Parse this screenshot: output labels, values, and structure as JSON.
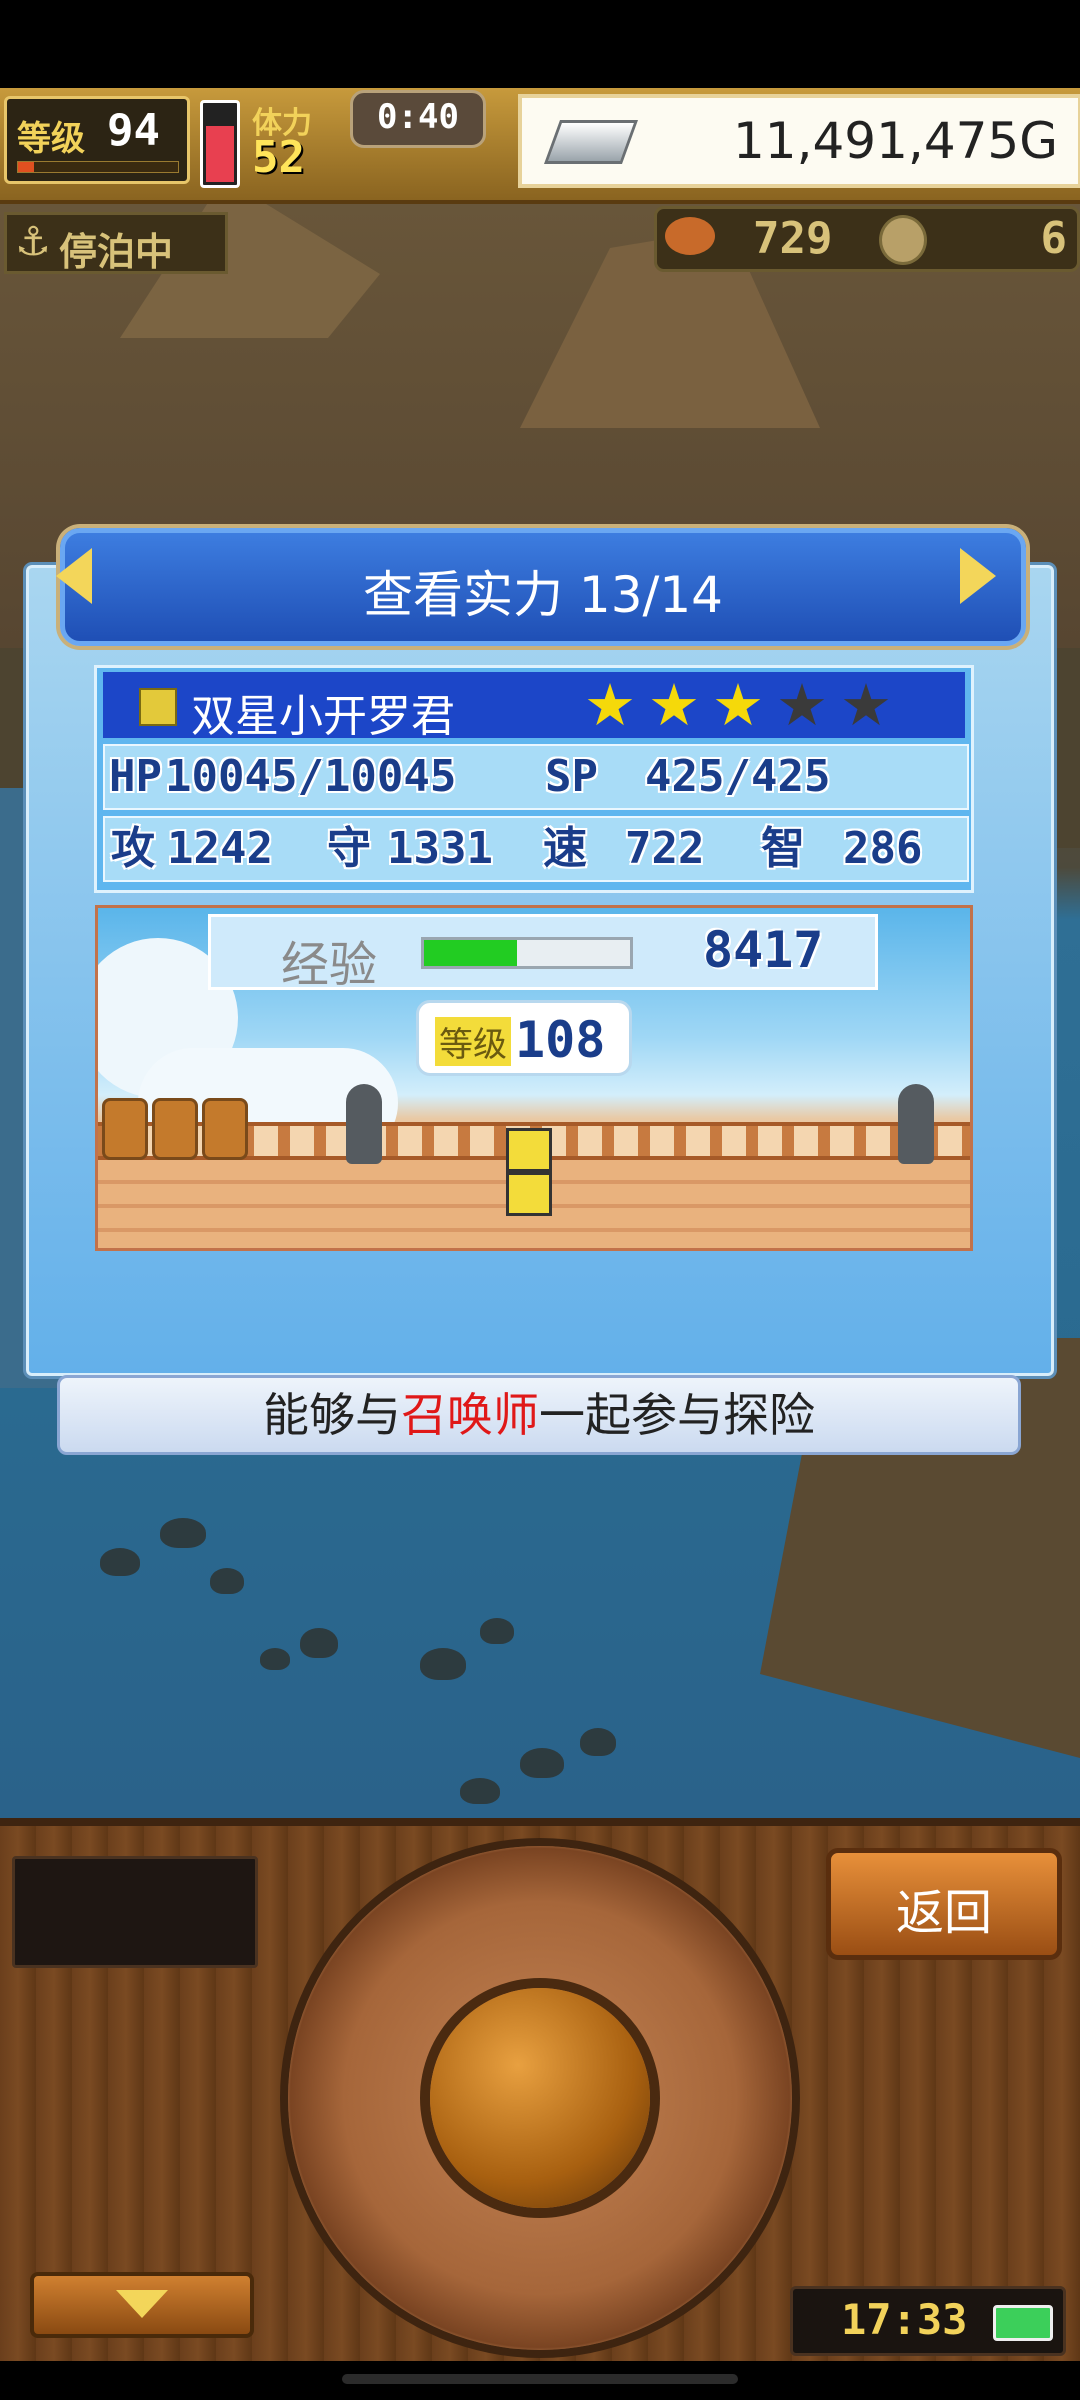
{
  "hud": {
    "level_label": "等级",
    "level_value": "94",
    "stamina_label": "体力",
    "stamina_value": "52",
    "timer": "0:40",
    "gold": "11,491,475G",
    "status": "停泊中",
    "food_value": "729",
    "medal_value": "6"
  },
  "dialog": {
    "title": "查看实力 13/14",
    "character_name": "双星小开罗君",
    "stars_filled": 3,
    "stars_total": 5,
    "hp_label": "HP",
    "hp_value": "10045/10045",
    "sp_label": "SP",
    "sp_value": "425/425",
    "atk_label": "攻",
    "atk_value": "1242",
    "def_label": "守",
    "def_value": "1331",
    "spd_label": "速",
    "spd_value": "722",
    "int_label": "智",
    "int_value": "286",
    "exp_label": "经验",
    "exp_value": "8417",
    "exp_fill": 0.45,
    "char_level_label": "等级",
    "char_level_value": "108",
    "subtitle_pre": "能够与",
    "subtitle_highlight": "召唤师",
    "subtitle_post": "一起参与探险"
  },
  "controls": {
    "back_label": "返回",
    "clock": "17:33"
  },
  "colors": {
    "highlight": "#e01818",
    "star_on": "#f5d90a",
    "star_off": "#3a3a3a",
    "exp_bar": "#22cc22"
  }
}
